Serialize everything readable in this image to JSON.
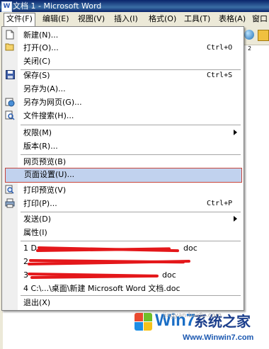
{
  "window": {
    "title": "文档 1 - Microsoft Word"
  },
  "menubar": {
    "items": [
      {
        "label": "文件(F)",
        "open": true
      },
      {
        "label": "编辑(E)"
      },
      {
        "label": "视图(V)"
      },
      {
        "label": "插入(I)"
      },
      {
        "label": "格式(O)"
      },
      {
        "label": "工具(T)"
      },
      {
        "label": "表格(A)"
      },
      {
        "label": "窗口"
      }
    ]
  },
  "ruler": {
    "marker": "2"
  },
  "file_menu": {
    "items": [
      {
        "icon": "new-document-icon",
        "label": "新建(N)..."
      },
      {
        "icon": "open-folder-icon",
        "label": "打开(O)...",
        "shortcut": "Ctrl+O"
      },
      {
        "label": "关闭(C)"
      },
      {
        "icon": "save-disk-icon",
        "label": "保存(S)",
        "shortcut": "Ctrl+S"
      },
      {
        "label": "另存为(A)..."
      },
      {
        "icon": "save-as-web-icon",
        "label": "另存为网页(G)..."
      },
      {
        "icon": "file-search-icon",
        "label": "文件搜索(H)..."
      },
      {
        "label": "权限(M)",
        "submenu": true
      },
      {
        "label": "版本(R)..."
      },
      {
        "label": "网页预览(B)"
      },
      {
        "label": "页面设置(U)...",
        "highlighted": true
      },
      {
        "icon": "print-preview-icon",
        "label": "打印预览(V)"
      },
      {
        "icon": "printer-icon",
        "label": "打印(P)...",
        "shortcut": "Ctrl+P"
      },
      {
        "label": "发送(D)",
        "submenu": true
      },
      {
        "label": "属性(I)"
      },
      {
        "label": "1 D:",
        "suffix": "doc"
      },
      {
        "label": "2 "
      },
      {
        "label": "3 ",
        "suffix": "doc"
      },
      {
        "label": "4 C:\\...\\桌面\\新建 Microsoft Word 文档.doc"
      },
      {
        "label": "退出(X)"
      }
    ]
  },
  "branding": {
    "win7_text": "Win7",
    "cn_text": "系统之家",
    "url": "Www.Winwin7.com",
    "watermark": "jingyan.baidu.com",
    "colors": {
      "accent": "#1a6ec6",
      "highlight": "#c1d2ee",
      "outline": "#c8463c",
      "scribble": "#e4171a"
    }
  }
}
